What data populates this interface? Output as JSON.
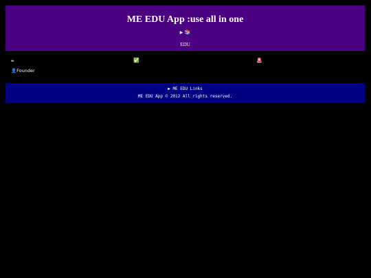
{
  "header": {
    "title": "ME EDU App :use all in one",
    "toggle_glyph": "▶",
    "books_icon": "📚",
    "subtitle": "EDU"
  },
  "icons_row": {
    "coffee": "☕",
    "check": "✅",
    "alarm": "🚨"
  },
  "founder": {
    "icon": "👤",
    "label": "Founder"
  },
  "footer": {
    "links_glyph": "▶",
    "links_label": "ME EDU Links",
    "copyright": "ME EDU App © 2012 All rights reserved."
  },
  "colors": {
    "header_bg": "#4b0082",
    "footer_bg": "#000080",
    "page_bg": "#000000"
  }
}
